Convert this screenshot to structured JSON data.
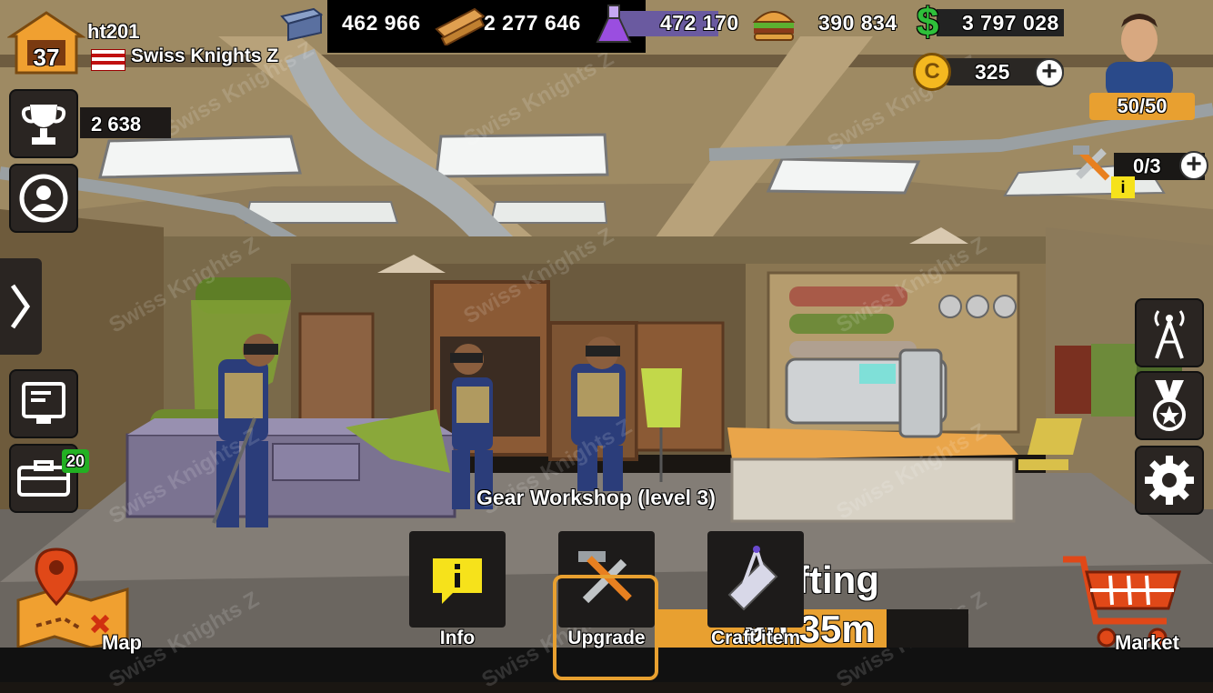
{
  "player": {
    "level": "37",
    "name": "ht201",
    "clan": "Swiss Knights Z"
  },
  "resources": {
    "steel": "462 966",
    "wood": "2 277 646",
    "chemicals": "472 170",
    "food": "390 834",
    "cash": "3 797 028"
  },
  "coins": "325",
  "energy": "50/50",
  "builders": "0/3",
  "trophies": "2 638",
  "garage_badge": "20",
  "building_label": "Gear Workshop (level 3)",
  "crafting": {
    "title": "Crafting",
    "timer": "9h 35m"
  },
  "actions": {
    "info": "Info",
    "upgrade": "Upgrade",
    "craft": "Craft item"
  },
  "nav": {
    "map": "Map",
    "market": "Market"
  },
  "watermark": "Swiss Knights Z",
  "colors": {
    "accent_orange": "#f0a030",
    "cash_green": "#2fbf3a",
    "info_yellow": "#f6e21b",
    "badge_green": "#22b022"
  }
}
